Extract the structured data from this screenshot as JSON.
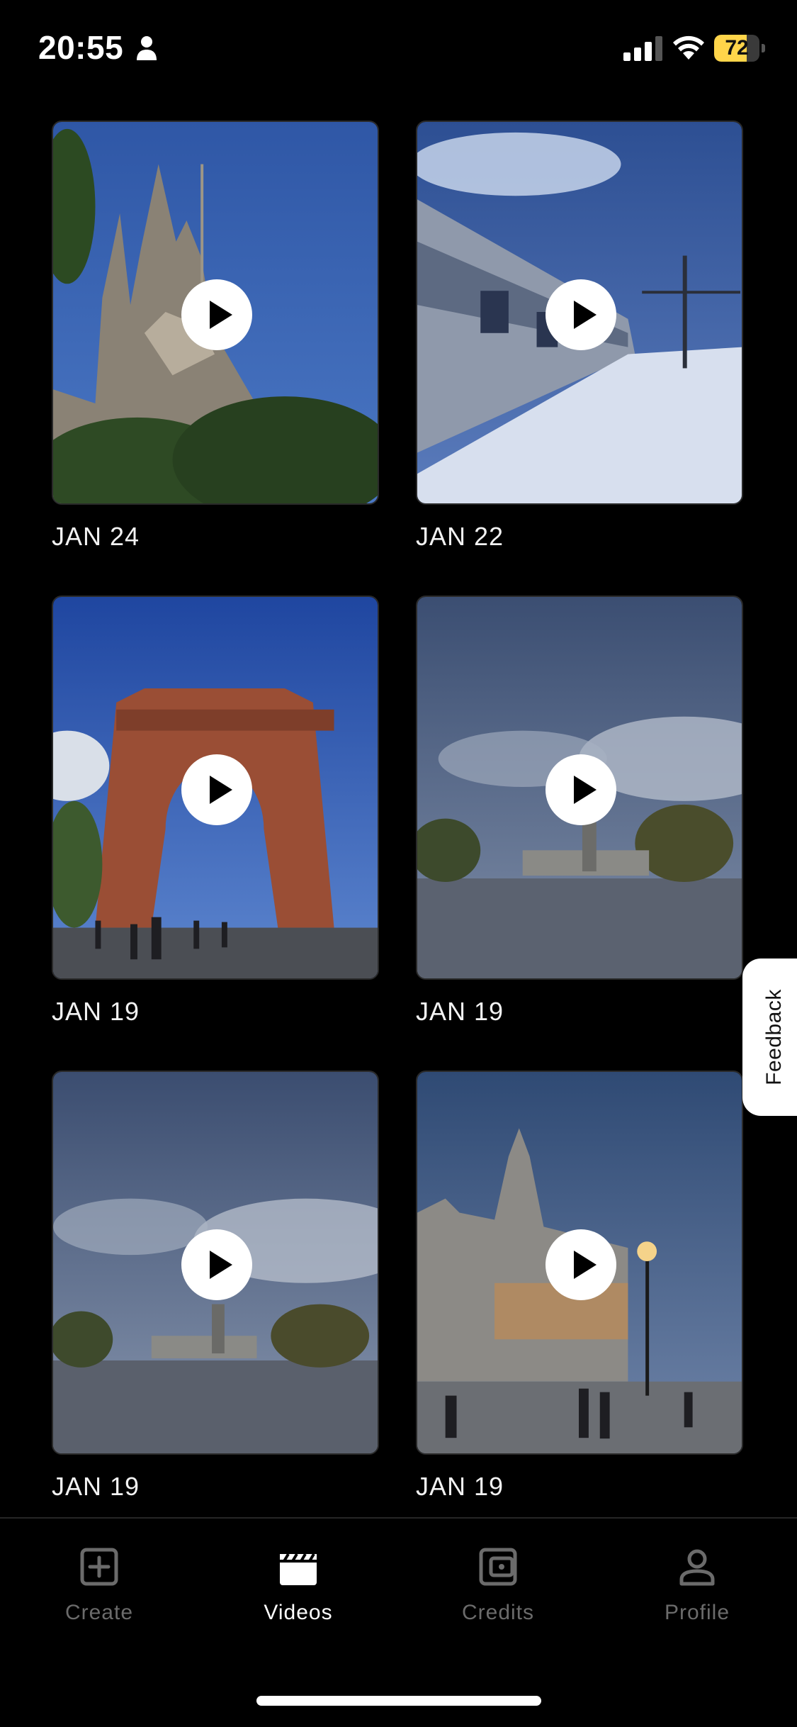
{
  "status_bar": {
    "time": "20:55",
    "battery": "72",
    "battery_level": 0.72,
    "accent_battery": "#ffd54a"
  },
  "videos": [
    {
      "date": "JAN 24",
      "thumbnail": "cathedral-spires"
    },
    {
      "date": "JAN 22",
      "thumbnail": "train-snowy-platform"
    },
    {
      "date": "JAN 19",
      "thumbnail": "brick-triumphal-arch"
    },
    {
      "date": "JAN 19",
      "thumbnail": "lake-monument"
    },
    {
      "date": "JAN 19",
      "thumbnail": "lake-monument-wide"
    },
    {
      "date": "JAN 19",
      "thumbnail": "cathedral-plaza-dusk"
    }
  ],
  "feedback_label": "Feedback",
  "tabs": [
    {
      "label": "Create",
      "icon": "plus-square-icon",
      "active": false
    },
    {
      "label": "Videos",
      "icon": "clapperboard-icon",
      "active": true
    },
    {
      "label": "Credits",
      "icon": "wallet-icon",
      "active": false
    },
    {
      "label": "Profile",
      "icon": "person-icon",
      "active": false
    }
  ]
}
